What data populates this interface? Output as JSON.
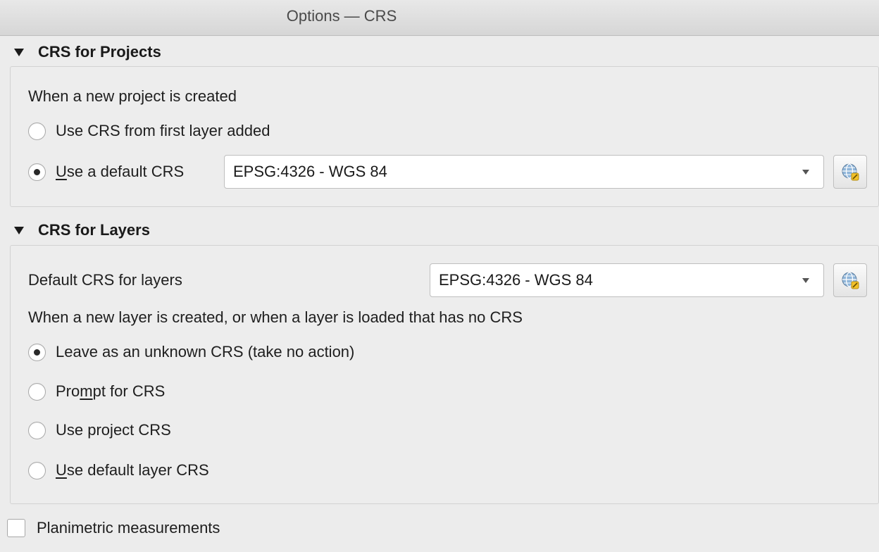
{
  "window": {
    "title": "Options — CRS"
  },
  "projects": {
    "header": "CRS for Projects",
    "prompt": "When a new project is created",
    "opt_first_layer": "Use CRS from first layer added",
    "opt_default_prefix": "U",
    "opt_default_rest": "se a default CRS",
    "opt_default_selected": true,
    "default_crs": "EPSG:4326 - WGS 84"
  },
  "layers": {
    "header": "CRS for Layers",
    "default_label": "Default CRS for layers",
    "default_crs": "EPSG:4326 - WGS 84",
    "prompt": "When a new layer is created, or when a layer is loaded that has no CRS",
    "opt_unknown": "Leave as an unknown CRS (take no action)",
    "opt_prompt_a": "Pro",
    "opt_prompt_u": "m",
    "opt_prompt_b": "pt for CRS",
    "opt_project_a": "Use pro",
    "opt_project_u": "j",
    "opt_project_b": "ect CRS",
    "opt_default_u": "U",
    "opt_default_rest": "se default layer CRS",
    "selected": "unknown"
  },
  "planimetric": {
    "label": "Planimetric measurements",
    "checked": false
  },
  "icons": {
    "crs_select": "globe-crs-select-icon",
    "dropdown": "chevron-down-icon",
    "collapse": "triangle-down-icon"
  }
}
